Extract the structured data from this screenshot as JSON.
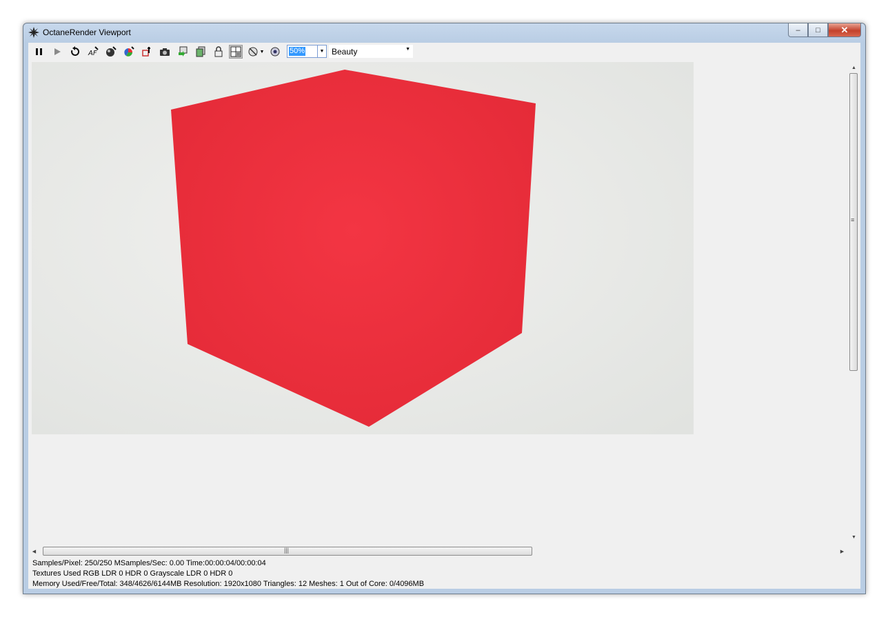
{
  "window": {
    "title": "OctaneRender Viewport"
  },
  "title_buttons": {
    "minimize": "–",
    "maximize": "□",
    "close": "✕"
  },
  "toolbar": {
    "icons": [
      "pause-icon",
      "play-icon",
      "restart-icon",
      "focus-picker-icon",
      "material-picker-icon",
      "color-picker-icon",
      "object-picker-icon",
      "camera-icon",
      "export-icon",
      "save-icon",
      "lock-icon",
      "region-render-icon",
      "film-region-icon",
      "zoom-icon"
    ],
    "zoom_value": "50%",
    "render_pass": "Beauty"
  },
  "render": {
    "background_color": "#e7e8e6",
    "cube_color": "#ec2e3a"
  },
  "status": {
    "line1": "Samples/Pixel: 250/250  MSamples/Sec: 0.00  Time:00:00:04/00:00:04",
    "line2": "Textures Used RGB LDR 0  HDR 0  Grayscale LDR 0  HDR 0",
    "line3": "Memory Used/Free/Total: 348/4626/6144MB  Resolution: 1920x1080  Triangles: 12  Meshes: 1 Out of Core: 0/4096MB"
  }
}
